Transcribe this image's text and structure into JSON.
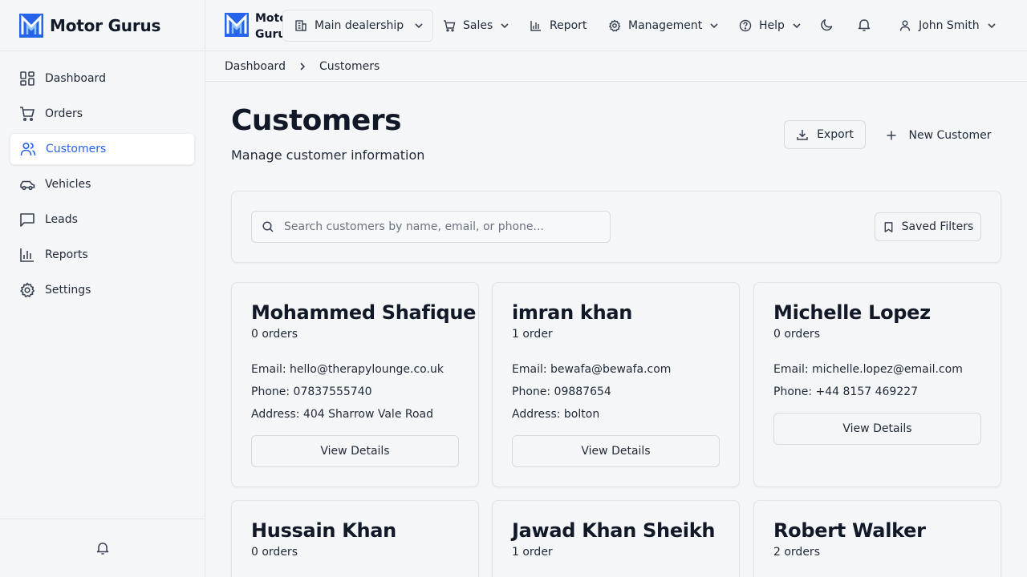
{
  "brand": {
    "name": "Motor Gurus",
    "short_name_line1": "Motor",
    "short_name_line2": "Gurus"
  },
  "sidebar": {
    "items": [
      {
        "label": "Dashboard",
        "icon": "dashboard-icon"
      },
      {
        "label": "Orders",
        "icon": "cart-icon"
      },
      {
        "label": "Customers",
        "icon": "users-icon",
        "active": true
      },
      {
        "label": "Vehicles",
        "icon": "car-icon"
      },
      {
        "label": "Leads",
        "icon": "message-icon"
      },
      {
        "label": "Reports",
        "icon": "bar-chart-icon"
      },
      {
        "label": "Settings",
        "icon": "gear-icon"
      }
    ],
    "footer_icon": "bell-icon"
  },
  "topbar": {
    "dealership": "Main dealership",
    "sales": "Sales",
    "report": "Report",
    "management": "Management",
    "help": "Help",
    "user": "John Smith"
  },
  "breadcrumb": {
    "root": "Dashboard",
    "current": "Customers"
  },
  "page": {
    "title": "Customers",
    "subtitle": "Manage customer information",
    "export_label": "Export",
    "new_label": "New Customer"
  },
  "search": {
    "placeholder": "Search customers by name, email, or phone...",
    "value": "",
    "saved_filters_label": "Saved Filters"
  },
  "customers": [
    {
      "name": "Mohammed Shafique",
      "orders": "0 orders",
      "email": "Email: hello@therapylounge.co.uk",
      "phone": "Phone: 07837555740",
      "address": "Address: 404 Sharrow Vale Road",
      "button": "View Details"
    },
    {
      "name": "imran khan",
      "orders": "1 order",
      "email": "Email: bewafa@bewafa.com",
      "phone": "Phone: 09887654",
      "address": "Address: bolton",
      "button": "View Details"
    },
    {
      "name": "Michelle Lopez",
      "orders": "0 orders",
      "email": "Email: michelle.lopez@email.com",
      "phone": "Phone: +44 8157 469227",
      "button": "View Details"
    },
    {
      "name": "Hussain Khan",
      "orders": "0 orders"
    },
    {
      "name": "Jawad Khan Sheikh",
      "orders": "1 order"
    },
    {
      "name": "Robert Walker",
      "orders": "2 orders"
    }
  ],
  "colors": {
    "accent": "#2563eb",
    "background": "#f5f6f8",
    "border": "#e1e3e7",
    "text": "#1f2937"
  }
}
